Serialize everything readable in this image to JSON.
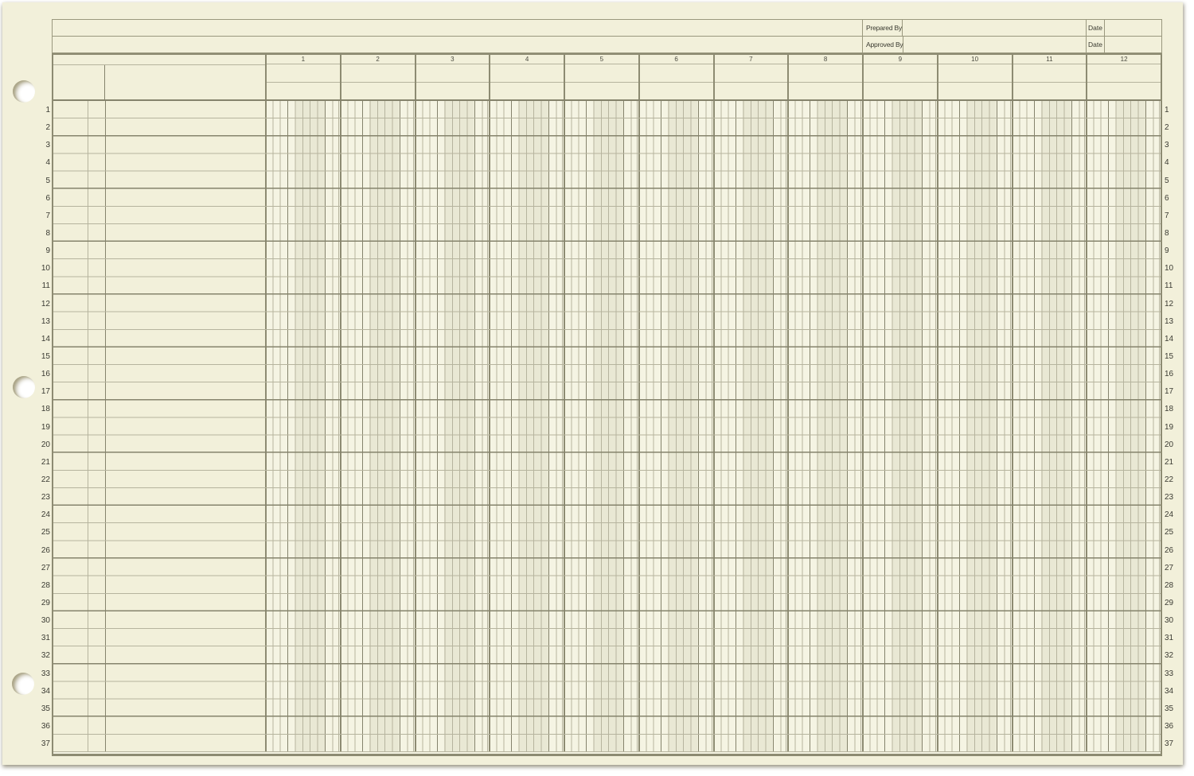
{
  "document_type": "columnar-ledger-sheet",
  "colors": {
    "paper-bg": "#f2f0da",
    "grid-bg": "#f5f4e3",
    "shade": "#e9e8d4",
    "thin": "#b6b49e",
    "heavy": "#85836c",
    "border": "#8d8b72",
    "ink": "#3a3a30"
  },
  "top_strip": {
    "rows": [
      {
        "label": "Prepared By",
        "field_value": "",
        "date_label": "Date",
        "date_value": ""
      },
      {
        "label": "Approved By",
        "field_value": "",
        "date_label": "Date",
        "date_value": ""
      }
    ]
  },
  "columns": {
    "count": 12,
    "labels": [
      "1",
      "2",
      "3",
      "4",
      "5",
      "6",
      "7",
      "8",
      "9",
      "10",
      "11",
      "12"
    ],
    "subcolumns_per_column": 10
  },
  "rows": {
    "count": 37,
    "numbers": [
      "1",
      "2",
      "3",
      "4",
      "5",
      "6",
      "7",
      "8",
      "9",
      "10",
      "11",
      "12",
      "13",
      "14",
      "15",
      "16",
      "17",
      "18",
      "19",
      "20",
      "21",
      "22",
      "23",
      "24",
      "25",
      "26",
      "27",
      "28",
      "29",
      "30",
      "31",
      "32",
      "33",
      "34",
      "35",
      "36",
      "37"
    ]
  },
  "punch_holes": {
    "count": 3
  }
}
